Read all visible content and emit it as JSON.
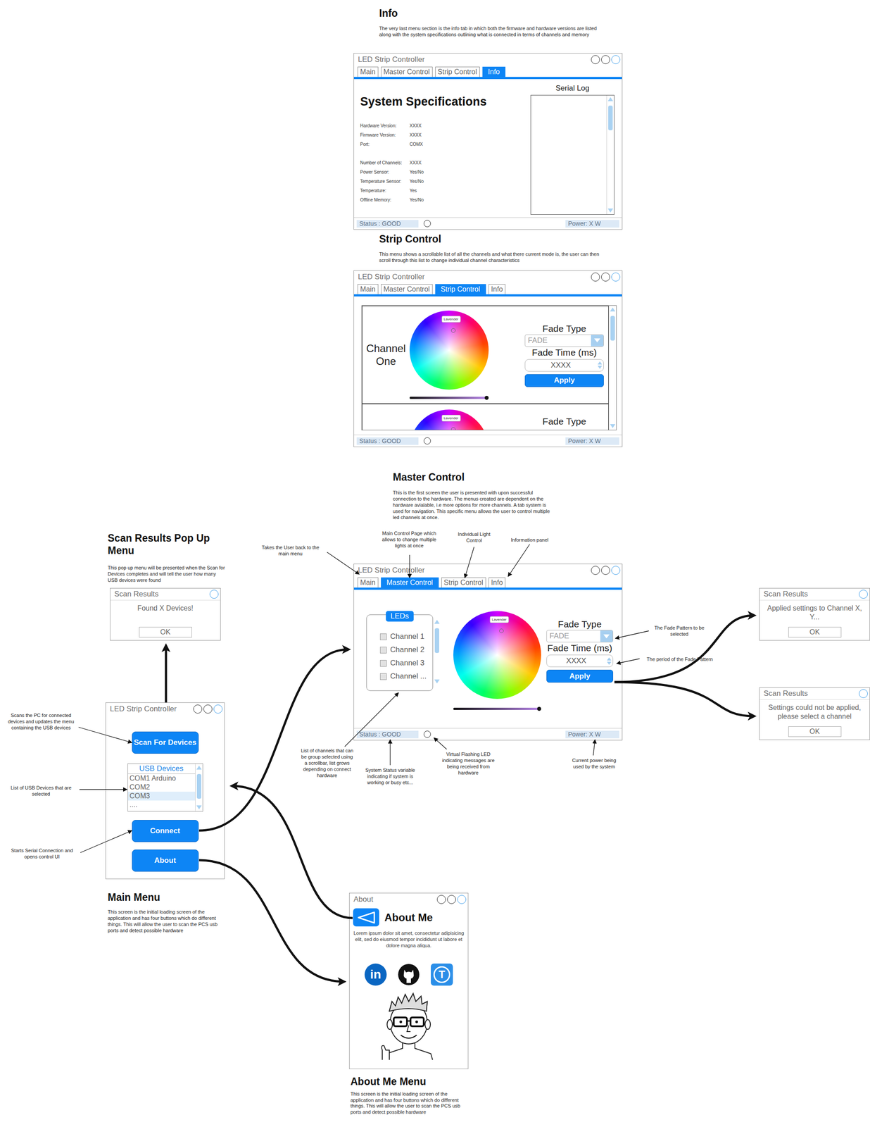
{
  "info_screen": {
    "heading": "Info",
    "description": "The very last menu section is the info tab in which both the firmware and hardware versions are listed along with the system specifications outlining what is connected in terms of channels and memory",
    "window": {
      "title": "LED Strip Controller",
      "tabs": [
        {
          "label": "Main",
          "selected": false
        },
        {
          "label": "Master Control",
          "selected": false
        },
        {
          "label": "Strip Control",
          "selected": false
        },
        {
          "label": "Info",
          "selected": true
        }
      ],
      "spec_title": "System Specifications",
      "spec_groups": [
        [
          {
            "label": "Hardware Version:",
            "value": "XXXX"
          },
          {
            "label": "Firmware Version:",
            "value": "XXXX"
          },
          {
            "label": "Port:",
            "value": "COMX"
          }
        ],
        [
          {
            "label": "Number of Channels:",
            "value": "XXXX"
          },
          {
            "label": "Power Sensor:",
            "value": "Yes/No"
          },
          {
            "label": "Temperature Sensor:",
            "value": "Yes/No"
          },
          {
            "label": "Temperature:",
            "value": "Yes"
          },
          {
            "label": "Offline Memory:",
            "value": "Yes/No"
          }
        ]
      ],
      "log_title": "Serial Log",
      "status": "Status : GOOD",
      "power": "Power: X W"
    }
  },
  "strip_screen": {
    "heading": "Strip Control",
    "description": "This menu shows a scrollable list of all the channels and what there current mode is, the user can then scroll through this list to change individual channel characteristics",
    "window": {
      "title": "LED Strip Controller",
      "tabs": [
        {
          "label": "Main",
          "selected": false
        },
        {
          "label": "Master Control",
          "selected": false
        },
        {
          "label": "Strip Control",
          "selected": true
        },
        {
          "label": "Info",
          "selected": false
        }
      ],
      "cards": [
        {
          "kind": "full",
          "name": "Channel One",
          "color_label": "Lavender",
          "brightness": 1,
          "fade_type_label": "Fade Type",
          "fade_type": "FADE",
          "fade_time_label": "Fade Time (ms)",
          "fade_time": "XXXX",
          "apply": "Apply"
        },
        {
          "kind": "cut",
          "color_label": "Lavender",
          "fade_type_label": "Fade Type"
        }
      ],
      "status": "Status : GOOD",
      "power": "Power: X W"
    }
  },
  "master_screen": {
    "heading": "Master Control",
    "description": "This is the first screen the user is presented with upon successful connection to the hardware. The menus created are dependent on the hardware avialable, i.e more options for more channels. A tab system is used for navigation. This specific menu allows the user to control multiple led channels at once.",
    "window": {
      "title": "LED Strip Controller",
      "tabs": [
        {
          "label": "Main",
          "selected": false
        },
        {
          "label": "Master Control",
          "selected": true
        },
        {
          "label": "Strip Control",
          "selected": false
        },
        {
          "label": "Info",
          "selected": false
        }
      ],
      "leds": {
        "title": "LEDs",
        "channels": [
          {
            "label": "Channel 1",
            "checked": false
          },
          {
            "label": "Channel 2",
            "checked": false
          },
          {
            "label": "Channel 3",
            "checked": false
          },
          {
            "label": "Channel ...",
            "checked": false
          }
        ]
      },
      "color_label": "Lavender",
      "brightness": 1,
      "fade_type_label": "Fade Type",
      "fade_type": "FADE",
      "fade_time_label": "Fade Time (ms)",
      "fade_time": "XXXX",
      "apply": "Apply",
      "status": "Status : GOOD",
      "power": "Power: X W"
    }
  },
  "scan_popup_screen": {
    "heading": "Scan Results Pop Up Menu",
    "description": "This pop up menu will be presented when the Scan for Devices completes and will tell the user how many USB devices were found",
    "popup": {
      "title": "Scan Results",
      "message": "Found X Devices!",
      "button": "OK"
    }
  },
  "main_screen": {
    "heading": "Main Menu",
    "description": "This screen is the initial loading screen of the application and has four buttons which do different things. This will allow the user to scan the PCS usb ports and detect possible hardware",
    "window": {
      "title": "LED Strip Controller",
      "scan_button": "Scan For Devices",
      "usb_list": {
        "title": "USB Devices",
        "items": [
          {
            "label": "COM1 Arduino",
            "selected": false
          },
          {
            "label": "COM2",
            "selected": false
          },
          {
            "label": "COM3",
            "selected": true
          },
          {
            "label": "....",
            "selected": false
          }
        ]
      },
      "connect_button": "Connect",
      "about_button": "About"
    }
  },
  "about_screen": {
    "heading": "About Me Menu",
    "description": "This screen is the initial loading screen of the application and has four buttons which do different things. This will allow the user to scan the PCS usb ports and detect possible hardware",
    "window": {
      "title": "About",
      "heading": "About Me",
      "text": "Lorem ipsum dolor sit amet, consectetur adipisicing elit, sed do eiusmod tempor incididunt ut labore et dolore magna aliqua.",
      "social": {
        "linkedin": "in",
        "tumblr": "T"
      }
    }
  },
  "result_popups": [
    {
      "title": "Scan Results",
      "message": "Applied settings to Channel X, Y...",
      "button": "OK"
    },
    {
      "title": "Scan Results",
      "message": "Settings could not be applied, please select a channel",
      "button": "OK"
    }
  ],
  "annotations": [
    "Takes the User back to the main menu",
    "Main Control Page which allows to change multiple lights at once",
    "Individual Light Control",
    "Information panel",
    "The Fade Pattern to be selected",
    "The period of the Fade Pattern",
    "List of channels that can be group selected using a scrollbar, list grows depending on connect hardware",
    "System Status variable indicating if system is working or busy etc...",
    "Virtual Flashing LED indicating messages are being received from hardware",
    "Current power being used by the system",
    "Scans the PC for connected devices and updates the menu containing the USB devices",
    "List of USB Devices that are selected",
    "Starts Serial Connection and opens control UI"
  ]
}
